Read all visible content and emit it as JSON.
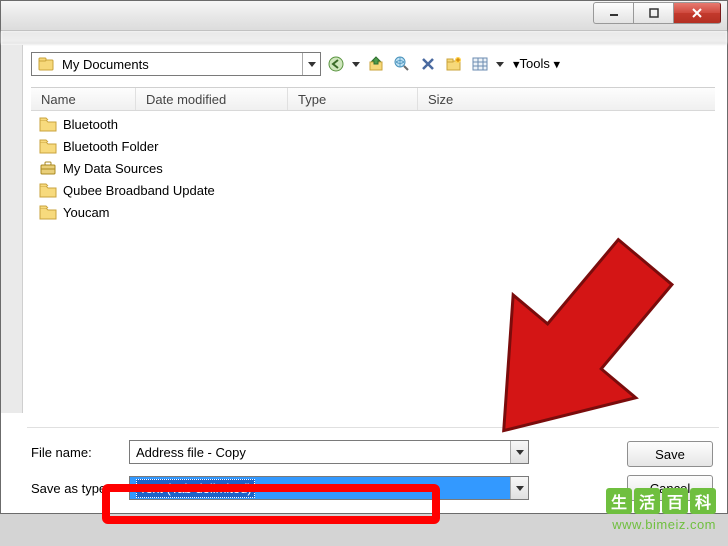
{
  "titlebar": {
    "minimize": "–",
    "maximize": "▢",
    "close": "✕"
  },
  "location": {
    "folder": "My Documents"
  },
  "toolbar": {
    "tools_label": "Tools"
  },
  "columns": {
    "name": "Name",
    "date": "Date modified",
    "type": "Type",
    "size": "Size"
  },
  "files": [
    {
      "name": "Bluetooth",
      "icon": "folder"
    },
    {
      "name": "Bluetooth Folder",
      "icon": "folder"
    },
    {
      "name": "My Data Sources",
      "icon": "briefcase"
    },
    {
      "name": "Qubee Broadband Update",
      "icon": "folder"
    },
    {
      "name": "Youcam",
      "icon": "folder"
    }
  ],
  "form": {
    "filename_label": "File name:",
    "filename_value": "Address file - Copy",
    "saveas_label": "Save as type:",
    "saveas_value": "Text (Tab delimited)"
  },
  "buttons": {
    "save": "Save",
    "cancel": "Cancel"
  },
  "watermark": {
    "chars": [
      "生",
      "活",
      "百",
      "科"
    ],
    "url": "www.bimeiz.com"
  }
}
